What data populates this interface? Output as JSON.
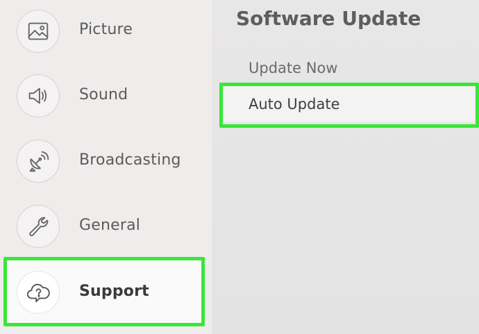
{
  "sidebar": {
    "items": [
      {
        "label": "Picture",
        "icon": "picture-icon"
      },
      {
        "label": "Sound",
        "icon": "speaker-icon"
      },
      {
        "label": "Broadcasting",
        "icon": "satellite-dish-icon"
      },
      {
        "label": "General",
        "icon": "wrench-icon"
      },
      {
        "label": "Support",
        "icon": "help-cloud-icon",
        "selected": true
      }
    ]
  },
  "main": {
    "title": "Software Update",
    "menu": [
      {
        "label": "Update Now"
      },
      {
        "label": "Auto Update",
        "focused": true
      }
    ]
  },
  "colors": {
    "highlight": "#39e639",
    "sidebar_bg": "#efecec",
    "content_bg": "#e8e7e7",
    "text": "#5b5b5b"
  }
}
